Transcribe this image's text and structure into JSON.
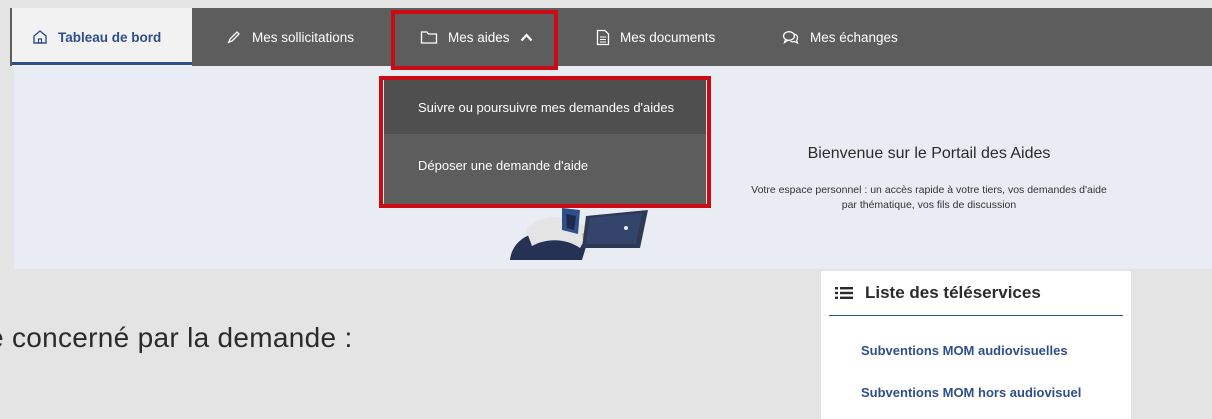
{
  "nav": {
    "tabs": [
      {
        "label": "Tableau de bord",
        "icon": "home-icon",
        "active": true
      },
      {
        "label": "Mes sollicitations",
        "icon": "pen-icon",
        "active": false
      },
      {
        "label": "Mes aides",
        "icon": "folder-icon",
        "active": false,
        "expanded": true
      },
      {
        "label": "Mes documents",
        "icon": "document-icon",
        "active": false
      },
      {
        "label": "Mes échanges",
        "icon": "chat-icon",
        "active": false
      }
    ]
  },
  "dropdown": {
    "items": [
      {
        "label": "Suivre ou poursuivre mes demandes d'aides"
      },
      {
        "label": "Déposer une demande d'aide"
      }
    ]
  },
  "hero": {
    "title": "Bienvenue sur le Portail des Aides",
    "subtitle_line1": "Votre espace personnel : un accès rapide à votre tiers, vos demandes d'aide",
    "subtitle_line2": "par thématique, vos fils de discussion"
  },
  "main": {
    "partial_heading": "e concerné par la demande :"
  },
  "teleservices": {
    "title": "Liste des téléservices",
    "icon": "list-icon",
    "items": [
      {
        "label": "Subventions MOM audiovisuelles"
      },
      {
        "label": "Subventions MOM hors audiovisuel"
      }
    ]
  },
  "colors": {
    "nav_bg": "#5d5d5d",
    "accent": "#2f4f8a",
    "highlight": "#cc0a14",
    "hero_bg": "#e9ecf2"
  }
}
